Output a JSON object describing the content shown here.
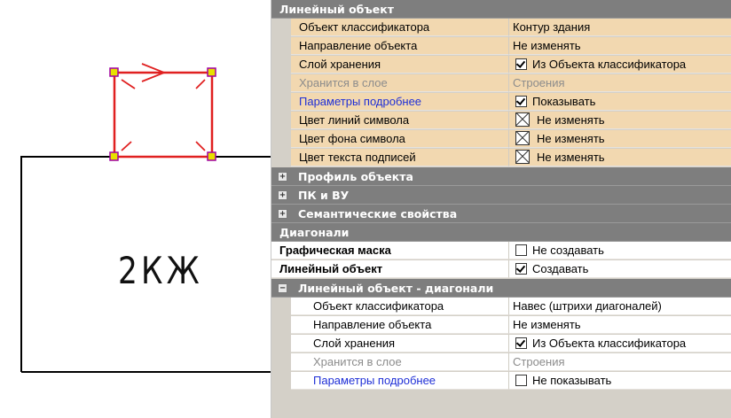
{
  "drawing": {
    "label": "2КЖ",
    "colors": {
      "symbol": "#e02020",
      "vertex": "#e8e000",
      "vertex_outline": "#a000a0",
      "line": "#000000"
    }
  },
  "grid": {
    "sections": {
      "linear_object": {
        "title": "Линейный объект"
      },
      "profile": {
        "title": "Профиль объекта"
      },
      "pk_vu": {
        "title": "ПК и ВУ"
      },
      "semantic": {
        "title": "Семантические свойства"
      },
      "diagonals": {
        "title": "Диагонали"
      },
      "linear_diag": {
        "title": "Линейный объект - диагонали"
      }
    },
    "linear_rows": [
      {
        "name": "Объект классификатора",
        "value": "Контур здания"
      },
      {
        "name": "Направление объекта",
        "value": "Не изменять"
      },
      {
        "name": "Слой хранения",
        "value": "Из Объекта классификатора"
      },
      {
        "name": "Хранится в слое",
        "value": "Строения"
      },
      {
        "name": "Параметры подробнее",
        "value": "Показывать"
      },
      {
        "name": "Цвет линий символа",
        "value": "Не изменять"
      },
      {
        "name": "Цвет фона символа",
        "value": "Не изменять"
      },
      {
        "name": "Цвет текста подписей",
        "value": "Не изменять"
      }
    ],
    "diagonal_rows": [
      {
        "name": "Графическая маска",
        "value": "Не создавать"
      },
      {
        "name": "Линейный объект",
        "value": "Создавать"
      }
    ],
    "diag_linear_rows": [
      {
        "name": "Объект классификатора",
        "value": "Навес (штрихи диагоналей)"
      },
      {
        "name": "Направление объекта",
        "value": "Не изменять"
      },
      {
        "name": "Слой хранения",
        "value": "Из Объекта классификатора"
      },
      {
        "name": "Хранится в слое",
        "value": "Строения"
      },
      {
        "name": "Параметры подробнее",
        "value": "Не показывать"
      }
    ],
    "expanders": {
      "plus": "+",
      "minus": "−"
    },
    "icons": {
      "checkbox": "checkbox-icon",
      "color_swatch": "color-none-icon",
      "expand": "plus-icon",
      "collapse": "minus-icon"
    }
  }
}
